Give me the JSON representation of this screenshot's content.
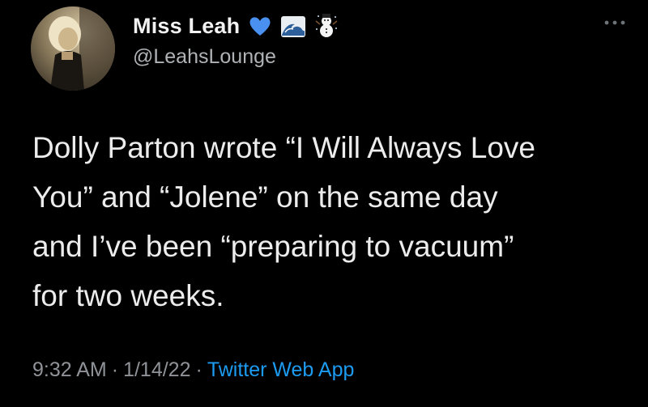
{
  "author": {
    "display_name": "Miss Leah",
    "handle": "@LeahsLounge",
    "name_emojis": [
      "blue-heart-icon",
      "wave-icon",
      "snowman-icon"
    ]
  },
  "tweet": {
    "lines": [
      "Dolly Parton wrote “I Will Always Love",
      "You” and “Jolene” on the same day",
      "and I’ve been “preparing to vacuum”",
      "for two weeks."
    ]
  },
  "meta": {
    "time": "9:32 AM",
    "separator": "·",
    "date": "1/14/22",
    "source": "Twitter Web App"
  },
  "colors": {
    "background": "#000000",
    "text": "#ececec",
    "secondary_text": "#8f9398",
    "link": "#1d9bf0",
    "heart": "#4a90f0"
  }
}
